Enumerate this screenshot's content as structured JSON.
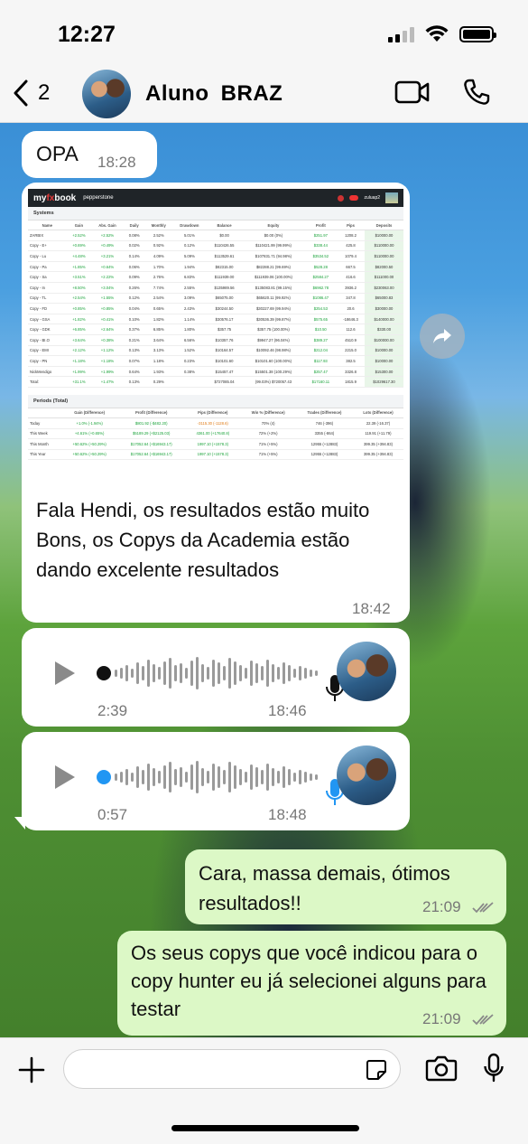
{
  "status_bar": {
    "time": "12:27"
  },
  "header": {
    "back_count": "2",
    "contact_name": "Aluno  BRAZ"
  },
  "messages": {
    "m1": {
      "text": "OPA",
      "time": "18:28"
    },
    "m2": {
      "caption": "Fala Hendi, os resultados estão muito Bons, os Copys da Academia estão dando excelente resultados",
      "time": "18:42",
      "screenshot": {
        "logo_a": "my",
        "logo_b": "fx",
        "logo_c": "book",
        "sponsor": "pepperstone",
        "user": "zuluap2",
        "section_systems": "Systems",
        "columns": [
          "Name",
          "Gain",
          "Abs. Gain",
          "Daily",
          "Monthly",
          "Drawdown",
          "Balance",
          "Equity",
          "Profit",
          "Pips",
          "Deposits"
        ],
        "rows": [
          [
            "ZARBIX",
            "+2.52%",
            "+2.52%",
            "0.08%",
            "2.52%",
            "5.01%",
            "$0.00",
            "$0.00 (0%)",
            "$251.97",
            "1208.2",
            "$10000.00"
          ],
          [
            "Copy - E+",
            "+0.69%",
            "+0.49%",
            "0.02%",
            "0.92%",
            "0.12%",
            "$110426.55",
            "$110421.99 (99.99%)",
            "$338.44",
            "425.8",
            "$110000.00"
          ],
          [
            "Copy - Lu",
            "+4.48%",
            "+3.21%",
            "0.14%",
            "4.09%",
            "5.09%",
            "$113529.61",
            "$107831.71 (94.98%)",
            "$3534.52",
            "1079.4",
            "$110000.00"
          ],
          [
            "Copy - Pa",
            "+1.85%",
            "+0.64%",
            "0.06%",
            "1.70%",
            "1.94%",
            "$82315.00",
            "$82288.21 (99.69%)",
            "$528.28",
            "667.5",
            "$82000.50"
          ],
          [
            "Copy - Sa",
            "+3.51%",
            "+2.22%",
            "0.09%",
            "2.76%",
            "6.83%",
            "$111939.00",
            "$111939.06 (100.00%)",
            "$2584.27",
            "416.6",
            "$111000.00"
          ],
          [
            "Copy - In",
            "+8.50%",
            "+3.04%",
            "0.26%",
            "7.74%",
            "2.55%",
            "$135989.56",
            "$135083.81 (99.15%)",
            "$6962.78",
            "3936.2",
            "$230063.00"
          ],
          [
            "Copy - TL",
            "+2.54%",
            "+1.55%",
            "0.12%",
            "2.54%",
            "3.09%",
            "$65075.00",
            "$65620.11 (99.92%)",
            "$1086.47",
            "347.8",
            "$65000.83"
          ],
          [
            "Copy - FD",
            "+0.85%",
            "+0.85%",
            "0.04%",
            "0.65%",
            "2.43%",
            "$30244.50",
            "$30227.69 (99.94%)",
            "$254.53",
            "20.6",
            "$30000.00"
          ],
          [
            "Copy - GSA",
            "+1.82%",
            "+0.41%",
            "0.10%",
            "1.82%",
            "1.14%",
            "$30576.17",
            "$30536.39 (99.87%)",
            "$575.65",
            "-18646.3",
            "$140000.00"
          ],
          [
            "Copy - GDK",
            "+6.85%",
            "+2.64%",
            "0.37%",
            "6.85%",
            "1.80%",
            "$357.75",
            "$357.75 (100.00%)",
            "$10.50",
            "112.6",
            "$330.00"
          ],
          [
            "Copy - BI.O",
            "+3.64%",
            "+0.38%",
            "0.21%",
            "3.64%",
            "6.56%",
            "$10357.76",
            "$9947.27 (96.04%)",
            "$389.27",
            "4510.9",
            "$100000.00"
          ],
          [
            "Copy - EMI",
            "+2.12%",
            "+1.12%",
            "0.13%",
            "3.13%",
            "1.52%",
            "$10164.57",
            "$10092.46 (98.98%)",
            "$212.04",
            "2215.0",
            "$10000.00"
          ],
          [
            "Copy - PN",
            "+1.18%",
            "+1.18%",
            "0.07%",
            "1.18%",
            "0.23%",
            "$10101.60",
            "$10101.60 (100.00%)",
            "$117.93",
            "382.5",
            "$10000.00"
          ],
          [
            "NickMendigo",
            "+1.99%",
            "+1.99%",
            "0.64%",
            "1.93%",
            "0.38%",
            "$15457.47",
            "$15501.38 (100.29%)",
            "$257.47",
            "3326.8",
            "$15300.00"
          ],
          [
            "Total:",
            "+31.1%",
            "+1.47%",
            "0.13%",
            "0.29%",
            "",
            "$727085.04",
            "(99.03%) $720057.43",
            "$17160.11",
            "1815.9",
            "$1029617.30"
          ]
        ],
        "section_periods": "Periods (Total)",
        "p_columns": [
          "",
          "Gain (Difference)",
          "Profit (Difference)",
          "Pips (Difference)",
          "Win % (Difference)",
          "Trades (Difference)",
          "Lots (Difference)"
        ],
        "p_rows": [
          [
            "Today",
            "+1.0% (-1.94%)",
            "$801.92 (-$482.20)",
            "-3115.30 (-1128.6)",
            "70% (4)",
            "746 (-396)",
            "22.39 (-16.37)"
          ],
          [
            "This Week",
            "+4.61% (+0.65%)",
            "$5189.29 (+$2125.03)",
            "4361.00 (+17640.8)",
            "72% (+2%)",
            "3355 (-864)",
            "119.91 (+11.79)"
          ],
          [
            "This Month",
            "+50.62% (+50.29%)",
            "$17052.64 (+$16943.17)",
            "1997.10 (+1578.3)",
            "71% (+5%)",
            "12955 (+12883)",
            "399.35 (+394.83)"
          ],
          [
            "This Year",
            "+50.62% (+50.29%)",
            "$17052.64 (+$16943.17)",
            "1997.10 (+1578.3)",
            "71% (+5%)",
            "12955 (+12883)",
            "399.35 (+394.83)"
          ]
        ]
      }
    },
    "m3": {
      "duration": "2:39",
      "time": "18:46"
    },
    "m4": {
      "duration": "0:57",
      "time": "18:48"
    },
    "m5": {
      "text": "Cara, massa demais, ótimos resultados!!",
      "time": "21:09"
    },
    "m6": {
      "text": "Os seus copys que você indicou para o copy hunter eu já selecionei alguns para testar",
      "time": "21:09"
    }
  },
  "colors": {
    "accent": "#007aff",
    "outgoing": "#dcf8c6",
    "incoming": "#ffffff",
    "played_dot": "#111111",
    "unplayed_dot": "#2196f3"
  },
  "icons": [
    "back-chevron-icon",
    "video-call-icon",
    "phone-icon",
    "forward-icon",
    "play-icon",
    "mic-icon",
    "read-ticks-icon",
    "plus-icon",
    "sticker-icon",
    "camera-icon"
  ]
}
